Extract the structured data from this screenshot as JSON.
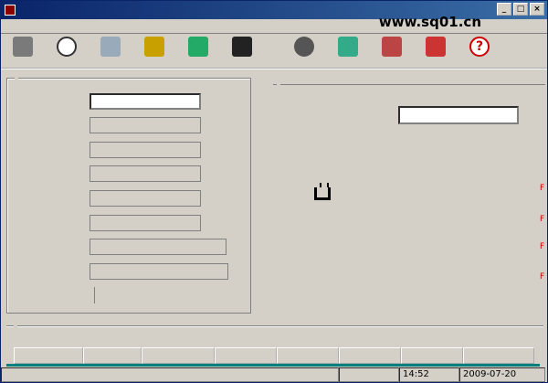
{
  "window": {
    "title": ""
  },
  "watermark": "www.sq01.cn",
  "menu": [
    {
      "label": ""
    },
    {
      "label": ""
    },
    {
      "label": ""
    },
    {
      "label": ""
    },
    {
      "label": ""
    },
    {
      "label": ""
    }
  ],
  "toolbar": [
    {
      "label": "",
      "icon": "backup-icon"
    },
    {
      "label": "",
      "icon": "clock-icon"
    },
    {
      "label": "",
      "icon": "category-icon"
    },
    {
      "label": "",
      "icon": "add-icon"
    },
    {
      "label": "",
      "icon": "edit-icon"
    },
    {
      "label": "",
      "icon": "search-icon"
    },
    {
      "label": "",
      "icon": "reader-icon"
    },
    {
      "label": "",
      "icon": "clear-icon"
    },
    {
      "label": "",
      "icon": "book-icon"
    },
    {
      "label": "",
      "icon": "return-icon"
    },
    {
      "label": "",
      "icon": "help-icon"
    }
  ],
  "basic": {
    "title": "",
    "fields": [
      {
        "label": ""
      },
      {
        "label": ""
      },
      {
        "label": ""
      },
      {
        "label": ""
      },
      {
        "label": ""
      },
      {
        "label": ""
      },
      {
        "label": ""
      },
      {
        "label": ""
      }
    ],
    "total_label": "",
    "total_unit": ""
  },
  "borrow": {
    "title": "",
    "prompt_line1": "",
    "prompt_line2": "",
    "hint": "",
    "side_hint1": "",
    "side_hint2": "",
    "plug_label": "",
    "links": [
      "",
      "",
      "",
      ""
    ]
  },
  "borrowed": {
    "title": "",
    "can_borrow": "",
    "columns": [
      "",
      "",
      "",
      "",
      "",
      "",
      "",
      ""
    ]
  },
  "status": {
    "left": "",
    "caps": "",
    "time": "14:52",
    "date": "2009-07-20"
  }
}
